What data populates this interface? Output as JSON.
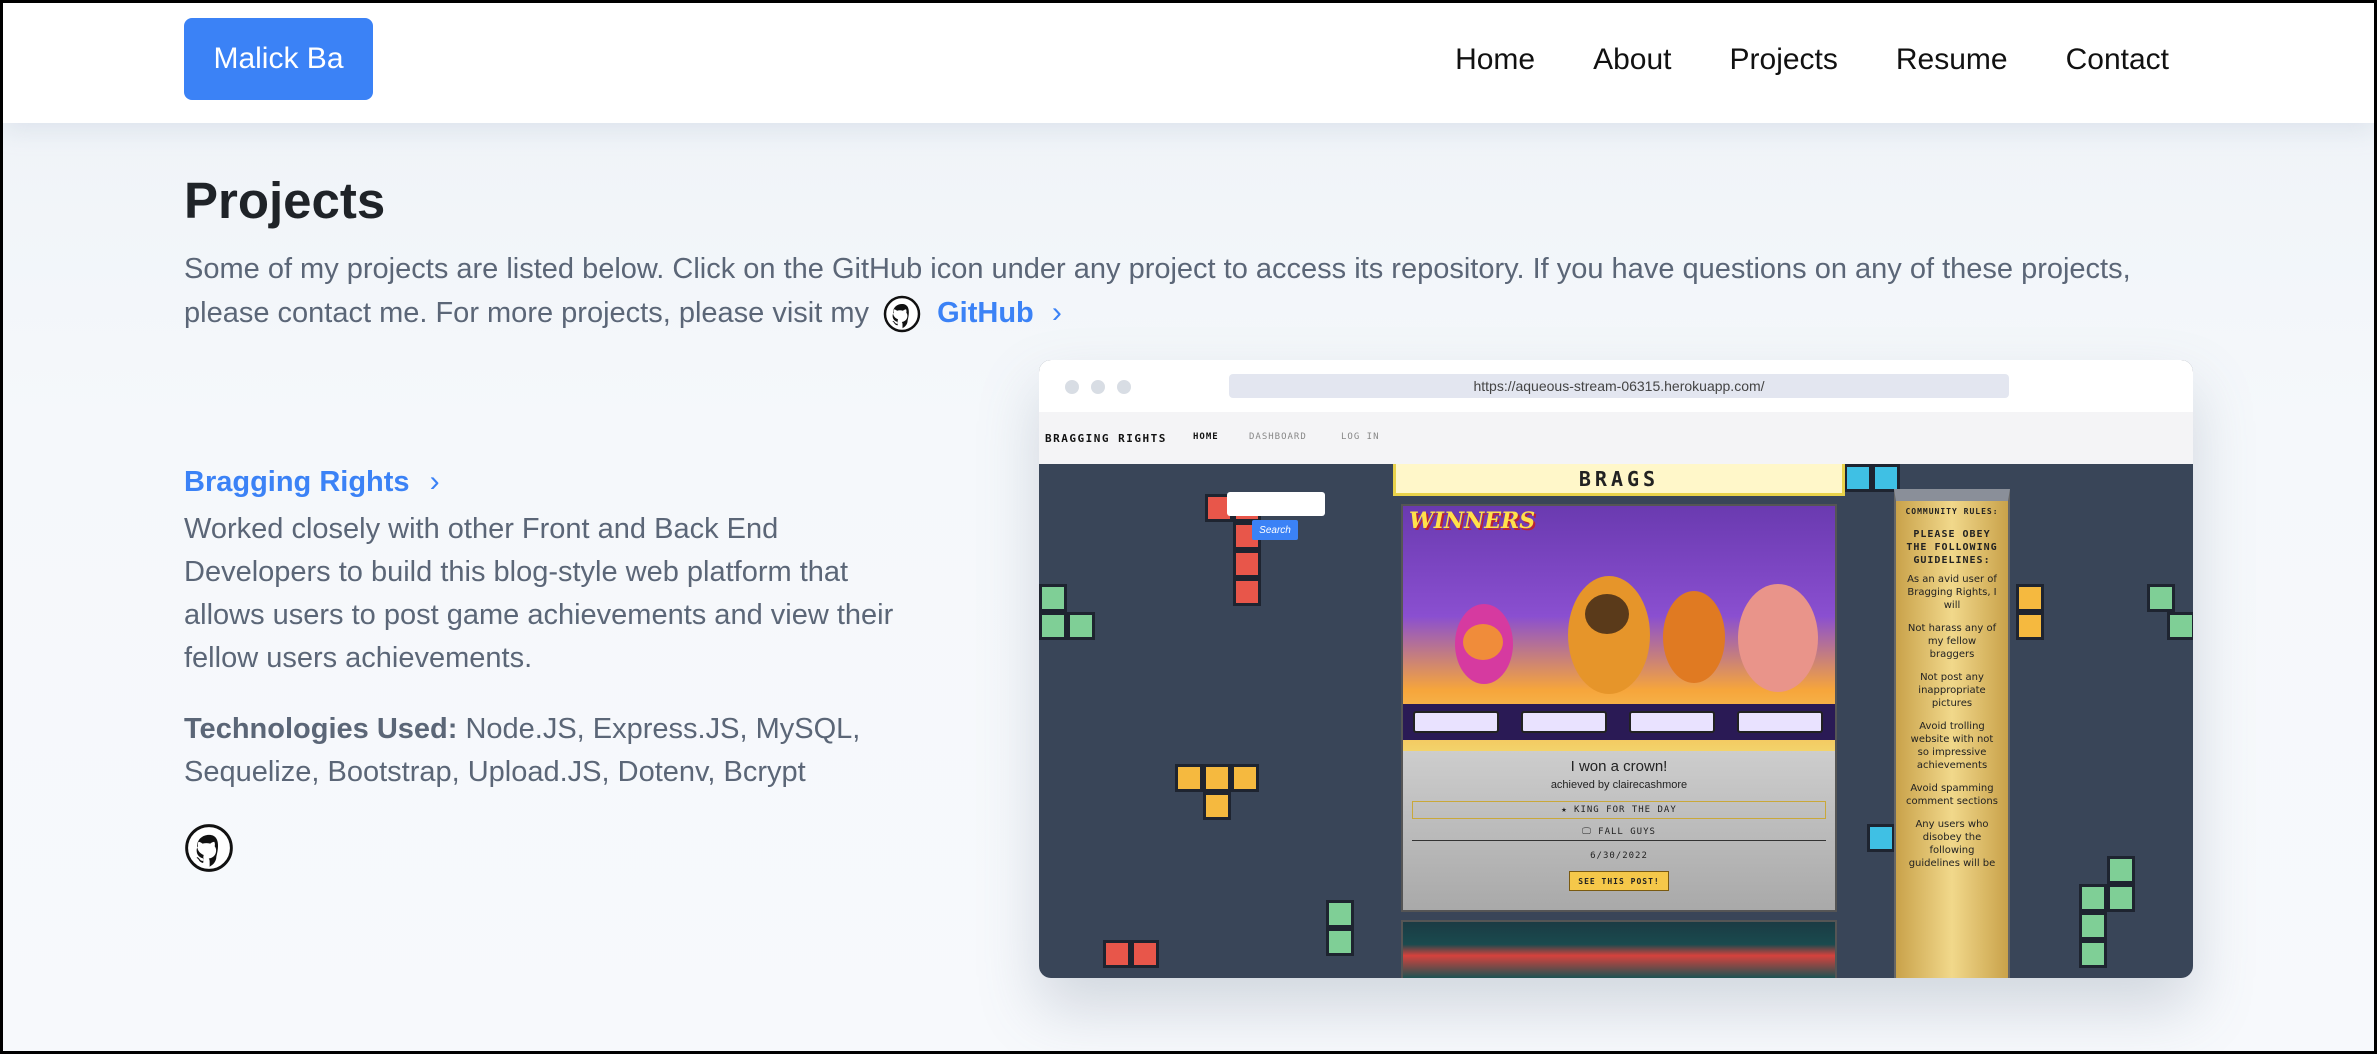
{
  "navbar": {
    "brand": "Malick Ba",
    "links": [
      "Home",
      "About",
      "Projects",
      "Resume",
      "Contact"
    ]
  },
  "header": {
    "title": "Projects",
    "intro": "Some of my projects are listed below. Click on the GitHub icon under any project to access its repository. If you have questions on any of these projects, please contact me. For more projects, please visit my",
    "github_link": "GitHub"
  },
  "project": {
    "title": "Bragging Rights",
    "description": "Worked closely with other Front and Back End Developers to build this blog-style web platform that allows users to post game achievements and view their fellow users achievements.",
    "tech_label": "Technologies Used:",
    "tech_list": "Node.JS, Express.JS, MySQL, Sequelize, Bootstrap, Upload.JS, Dotenv, Bcrypt"
  },
  "screenshot": {
    "url": "https://aqueous-stream-06315.herokuapp.com/",
    "site_brand": "BRAGGING RIGHTS",
    "site_links": [
      "HOME",
      "DASHBOARD",
      "LOG IN"
    ],
    "search_label": "Search",
    "brags_title": "BRAGS",
    "card_banner": "WINNERS",
    "card_title": "I won a crown!",
    "card_author": "achieved by clairecashmore",
    "card_badge": "★ KING FOR THE DAY",
    "card_game": "🖵 FALL GUYS",
    "card_date": "6/30/2022",
    "card_button": "SEE THIS POST!",
    "rules_title": "COMMUNITY RULES:",
    "rules_heading": "PLEASE OBEY THE FOLLOWING GUIDELINES:",
    "rules": [
      "As an avid user of Bragging Rights, I will",
      "Not harass any of my fellow braggers",
      "Not post any inappropriate pictures",
      "Avoid trolling website with not so impressive achievements",
      "Avoid spamming comment sections",
      "Any users who disobey the following guidelines will be"
    ]
  },
  "colors": {
    "accent": "#3b82f6",
    "text_muted": "#5b6677",
    "title": "#1f2328"
  }
}
